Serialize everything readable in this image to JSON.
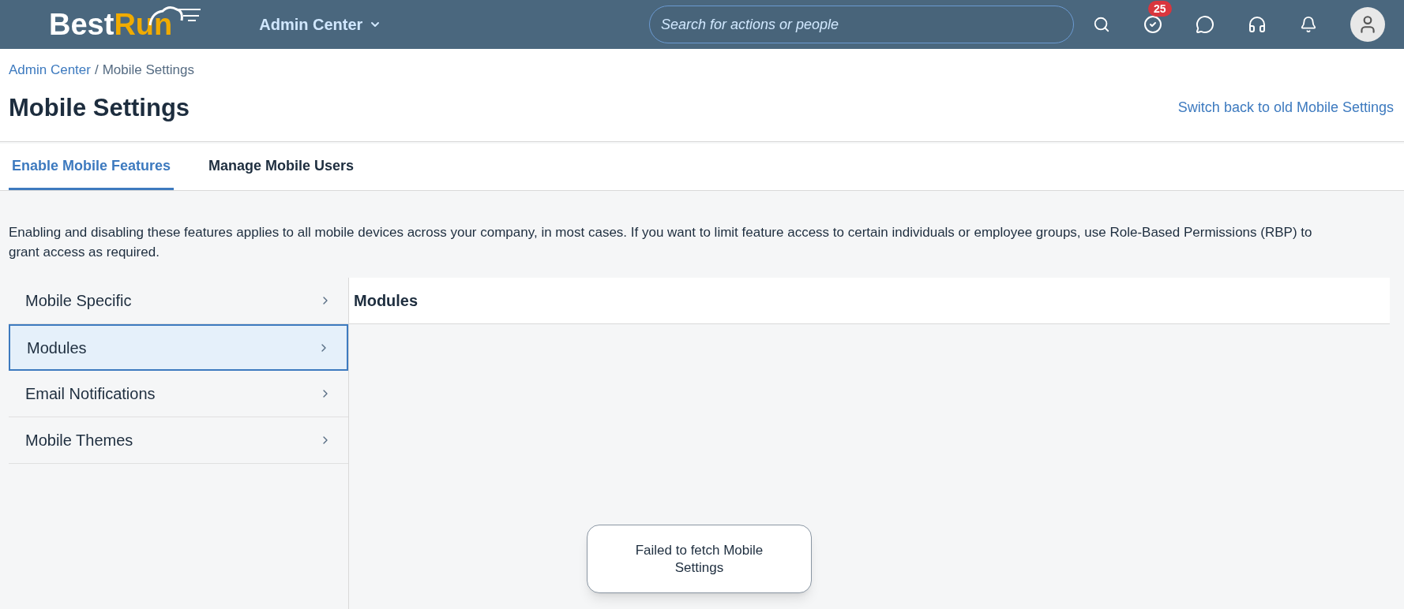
{
  "header": {
    "logo": {
      "first": "Best",
      "second": "Run"
    },
    "menu": "Admin Center",
    "search": {
      "placeholder": "Search for actions or people"
    },
    "todo_badge": "25"
  },
  "breadcrumb": [
    {
      "label": "Admin Center",
      "kind": "link"
    },
    {
      "label": "/",
      "kind": "separator"
    },
    {
      "label": "Mobile Settings",
      "kind": "current"
    }
  ],
  "title": "Mobile Settings",
  "switch_link": "Switch back to old Mobile Settings",
  "tabs": [
    {
      "label": "Enable Mobile Features",
      "selected": true
    },
    {
      "label": "Manage Mobile Users",
      "selected": false
    }
  ],
  "description": "Enabling and disabling these features applies to all mobile devices across your company, in most cases. If you want to limit feature access to certain individuals or employee groups, use Role-Based Permissions (RBP) to grant access as required.",
  "sidebar": {
    "items": [
      {
        "label": "Mobile Specific",
        "selected": false
      },
      {
        "label": "Modules",
        "selected": true
      },
      {
        "label": "Email Notifications",
        "selected": false
      },
      {
        "label": "Mobile Themes",
        "selected": false
      }
    ]
  },
  "panel": {
    "title": "Modules"
  },
  "toast": "Failed to fetch Mobile Settings"
}
